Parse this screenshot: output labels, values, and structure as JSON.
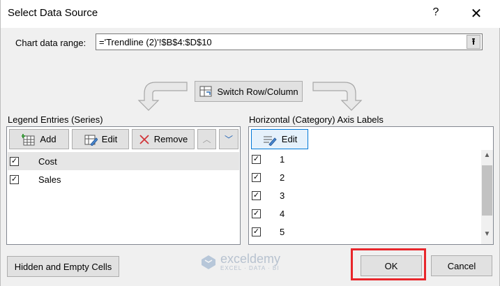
{
  "window": {
    "title": "Select Data Source",
    "help_glyph": "?",
    "close_glyph": "✕"
  },
  "range": {
    "label": "Chart data range:",
    "value": "='Trendline (2)'!$B$4:$D$10",
    "collapse_glyph": "⭱"
  },
  "switch_button": {
    "label": "Switch Row/Column"
  },
  "legend": {
    "label": "Legend Entries (Series)",
    "add_label": "Add",
    "edit_label": "Edit",
    "remove_label": "Remove",
    "up_glyph": "︿",
    "down_glyph": "﹀",
    "items": [
      {
        "label": "Cost",
        "checked": "✓"
      },
      {
        "label": "Sales",
        "checked": "✓"
      }
    ]
  },
  "axis": {
    "label": "Horizontal (Category) Axis Labels",
    "edit_label": "Edit",
    "items": [
      {
        "label": "1",
        "checked": "✓"
      },
      {
        "label": "2",
        "checked": "✓"
      },
      {
        "label": "3",
        "checked": "✓"
      },
      {
        "label": "4",
        "checked": "✓"
      },
      {
        "label": "5",
        "checked": "✓"
      }
    ],
    "scroll_up_glyph": "▲",
    "scroll_down_glyph": "▼"
  },
  "footer": {
    "hidden_cells_label": "Hidden and Empty Cells",
    "ok_label": "OK",
    "cancel_label": "Cancel"
  },
  "watermark": {
    "name": "exceldemy",
    "tagline": "EXCEL · DATA · BI"
  },
  "colors": {
    "accent": "#0078d7",
    "highlight": "#e8262b",
    "remove_icon": "#d13438"
  }
}
